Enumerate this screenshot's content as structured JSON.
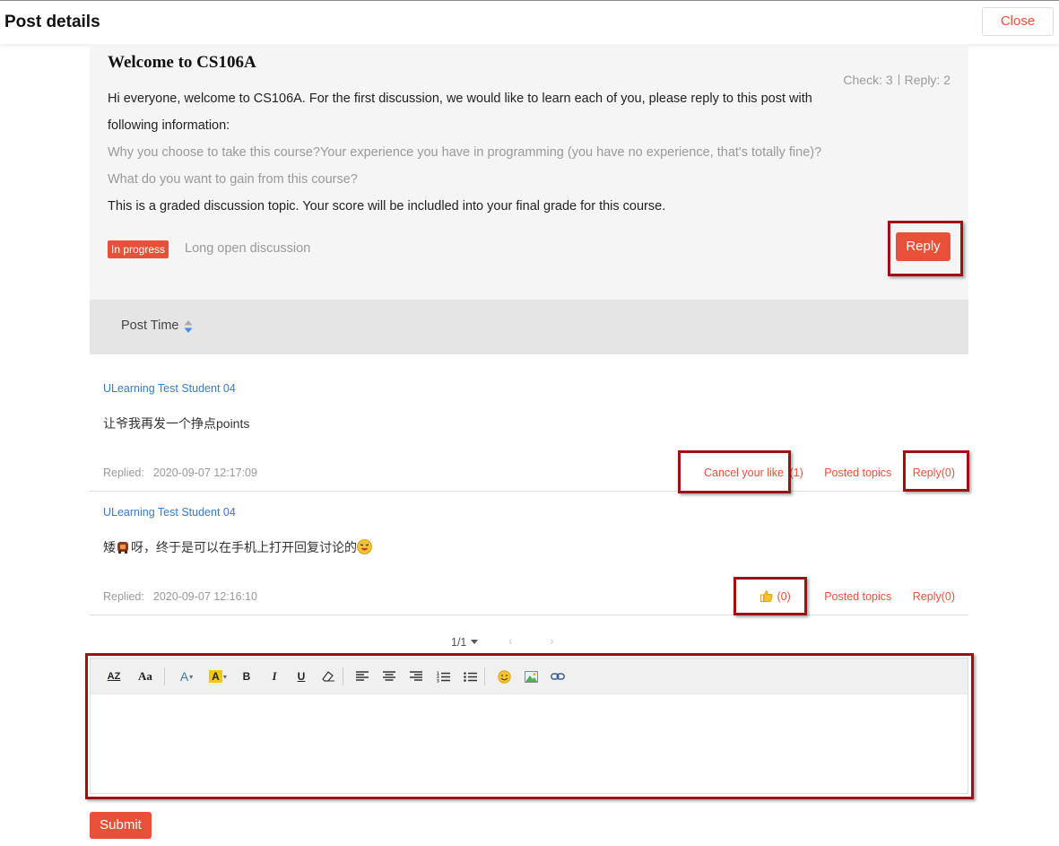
{
  "header": {
    "title": "Post details",
    "close_label": "Close"
  },
  "post": {
    "title": "Welcome to CS106A",
    "stats": {
      "check": "Check: 3",
      "reply": "Reply: 2"
    },
    "lines": [
      "Hi everyone, welcome to CS106A. For the first discussion, we would like to learn each of you, please reply to this post with",
      "following information:",
      "Why you choose to take this course?Your experience you have in programming (you have no experience, that's totally fine)?",
      "What do you want to gain from this course?",
      "This is a graded discussion topic. Your score will be includled into your final grade for this course."
    ],
    "status_badge": "In progress",
    "status_text": "Long open discussion",
    "reply_label": "Reply"
  },
  "sort": {
    "label": "Post Time"
  },
  "replies": [
    {
      "author": "ULearning Test Student 04",
      "content": "让爷我再发一个挣点points",
      "date_label": "Replied:",
      "date": "2020-09-07 12:17:09",
      "like_label": "Cancel your like",
      "like_count": "(1)",
      "posted_topics": "Posted topics",
      "reply": "Reply(0)"
    },
    {
      "author": "ULearning Test Student 04",
      "content_before": "矮",
      "content_after": "呀，终于是可以在手机上打开回复讨论的",
      "date_label": "Replied:",
      "date": "2020-09-07 12:16:10",
      "like_count": "(0)",
      "posted_topics": "Posted topics",
      "reply": "Reply(0)"
    }
  ],
  "pager": {
    "page": "1/1",
    "prev": "‹",
    "next": "›"
  },
  "toolbar": {
    "font_size_label": "AZ",
    "font_family_label": "Aa",
    "font_color_label": "A",
    "highlight_label": "A",
    "bold_label": "B",
    "italic_label": "I",
    "underline_label": "U"
  },
  "submit_label": "Submit",
  "colors": {
    "accent": "#e8503a",
    "author_link": "#3a78c3",
    "highlight_box": "#a40d12"
  }
}
